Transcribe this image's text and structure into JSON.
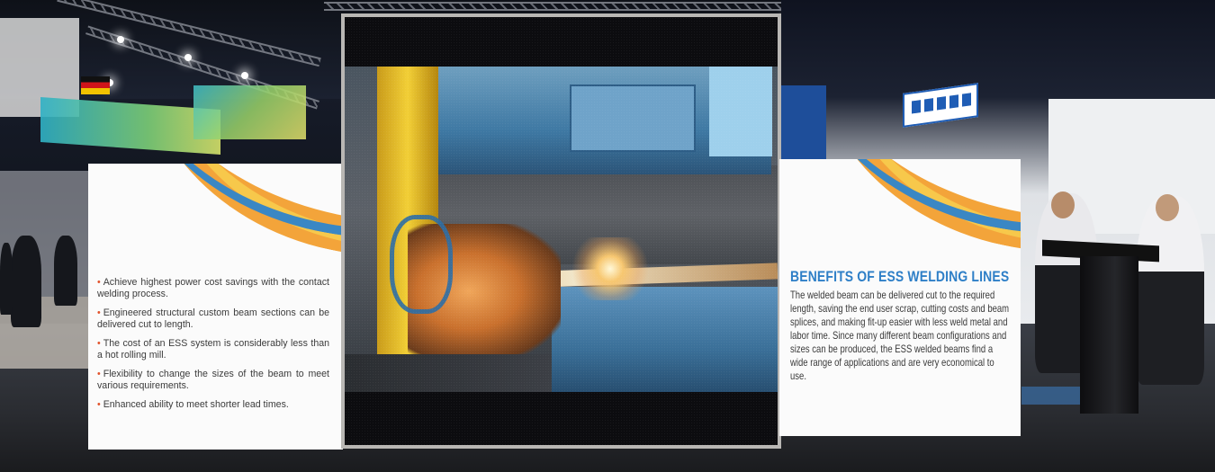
{
  "left_panel": {
    "bullets": [
      "Achieve highest power cost savings with the contact welding process.",
      "Engineered structural custom beam sections can be delivered cut to length.",
      "The cost of an ESS system is considerably less than a hot rolling mill.",
      "Flexibility to change the sizes of the beam to meet various requirements.",
      "Enhanced ability to meet shorter lead times."
    ]
  },
  "right_panel": {
    "title": "BENEFITS OF ESS WELDING LINES",
    "body": "The welded beam can be delivered cut to the required length, saving the end user scrap, cutting costs and beam splices, and making fit-up easier with less weld metal and labor time. Since many different beam configurations and sizes can be produced, the ESS welded beams find a wide range of applications and are very economical to use."
  },
  "colors": {
    "accent_blue": "#2e7fc7",
    "bullet_orange": "#e2512a",
    "swoosh_orange": "#f3a43a",
    "swoosh_blue": "#3a87c4"
  }
}
